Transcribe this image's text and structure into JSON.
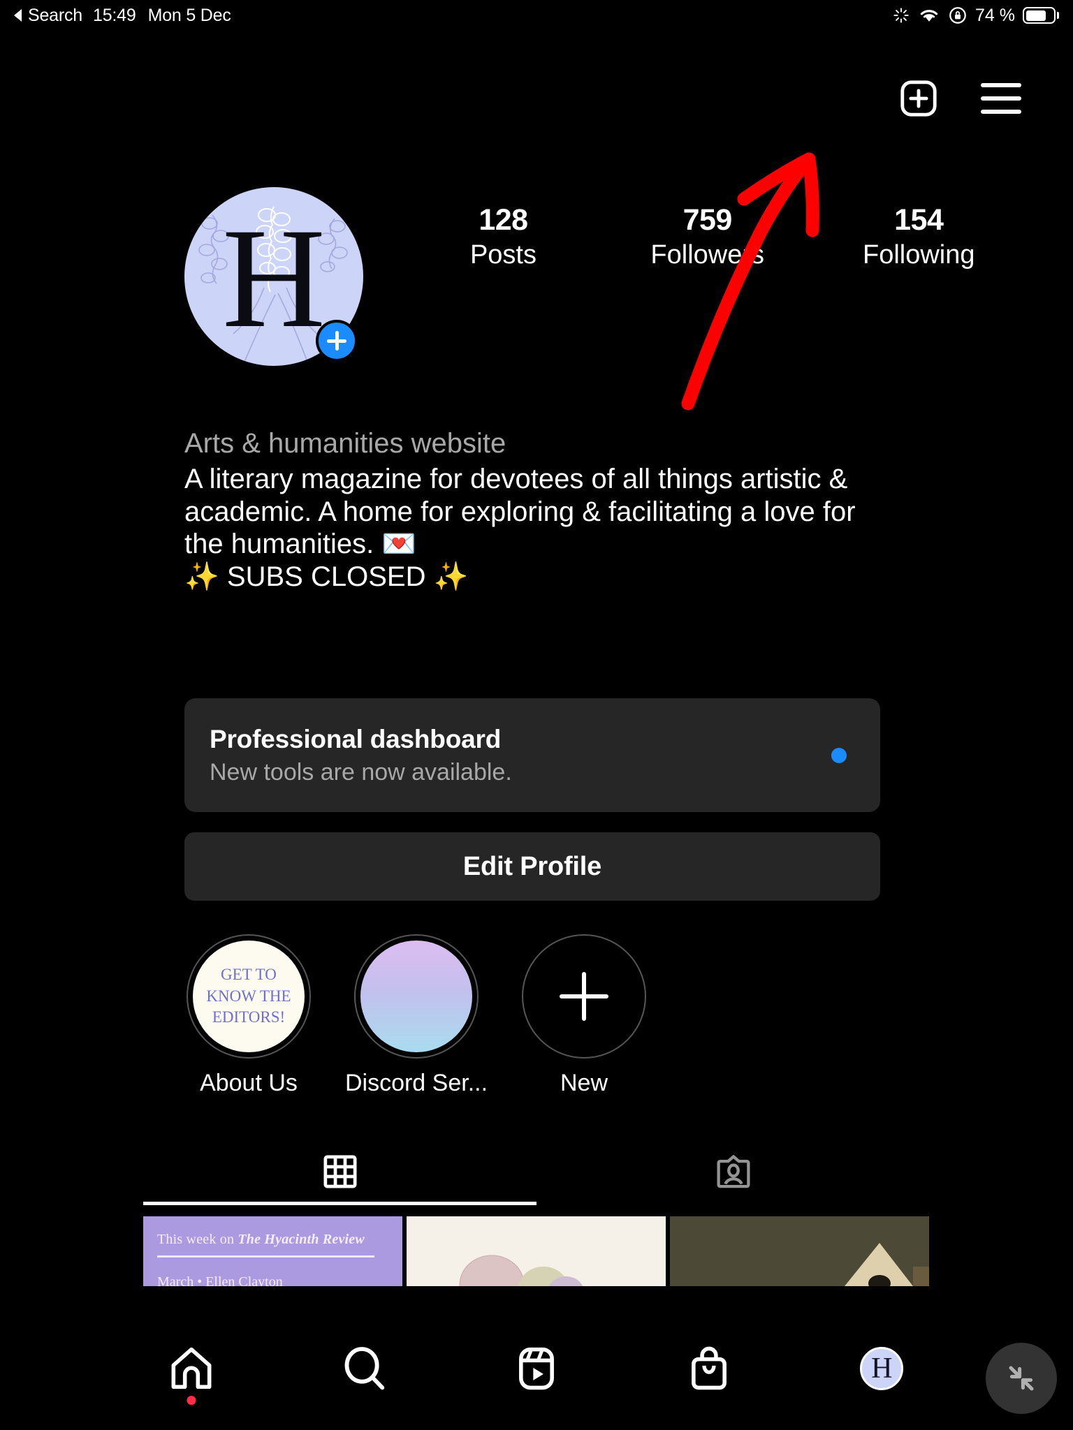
{
  "status_bar": {
    "back_label": "Search",
    "time": "15:49",
    "date": "Mon 5 Dec",
    "battery_percent": "74 %",
    "icons": [
      "back-triangle-icon",
      "spinner-icon",
      "wifi-icon",
      "rotation-lock-icon",
      "battery-icon"
    ]
  },
  "header": {
    "new_post_icon": "plus-square-icon",
    "menu_icon": "hamburger-menu-icon"
  },
  "profile": {
    "avatar_letter": "H",
    "avatar_bg": "#ccd4f7",
    "add_story_icon": "plus-icon",
    "stats": [
      {
        "num": "128",
        "label": "Posts"
      },
      {
        "num": "759",
        "label": "Followers"
      },
      {
        "num": "154",
        "label": "Following"
      }
    ],
    "category": "Arts & humanities website",
    "bio": "A literary magazine for devotees of all things artistic & academic. A home for exploring & facilitating a love for the humanities. 💌\n✨ SUBS CLOSED ✨"
  },
  "dashboard_card": {
    "title": "Professional dashboard",
    "subtitle": "New tools are now available.",
    "badge_color": "#1a8cff"
  },
  "edit_profile": {
    "label": "Edit Profile"
  },
  "highlights": [
    {
      "label": "About Us",
      "cover_text": "GET TO\nKNOW THE\nEDITORS!",
      "type": "text-cover"
    },
    {
      "label": "Discord Ser...",
      "cover_text": "",
      "type": "gradient-cover"
    },
    {
      "label": "New",
      "cover_text": "",
      "type": "new-plus"
    }
  ],
  "tabs": [
    {
      "name": "grid",
      "icon": "grid-icon",
      "active": true
    },
    {
      "name": "tagged",
      "icon": "tagged-person-icon",
      "active": false
    }
  ],
  "posts": [
    {
      "caption_line1_plain": "This week on ",
      "caption_line1_italic": "The Hyacinth Review",
      "caption_line2": "March • Ellen Clayton",
      "bg": "#ab9ae0"
    },
    {
      "caption_line1_plain": "",
      "caption_line1_italic": "",
      "caption_line2": "",
      "bg": "#f5f1e8"
    },
    {
      "caption_line1_plain": "",
      "caption_line1_italic": "",
      "caption_line2": "",
      "bg": "#4c4a37"
    }
  ],
  "bottom_nav": [
    {
      "name": "home",
      "icon": "home-icon",
      "badge": true
    },
    {
      "name": "search",
      "icon": "search-icon",
      "badge": false
    },
    {
      "name": "reels",
      "icon": "reels-icon",
      "badge": false
    },
    {
      "name": "shop",
      "icon": "shop-bag-icon",
      "badge": false
    },
    {
      "name": "profile",
      "icon": "profile-avatar-icon",
      "badge": false,
      "avatar_letter": "H"
    }
  ],
  "float_button": {
    "icon": "shrink-arrows-icon"
  },
  "annotation": {
    "color": "#ff0000",
    "type": "arrow",
    "points_to": "hamburger-menu-icon"
  }
}
